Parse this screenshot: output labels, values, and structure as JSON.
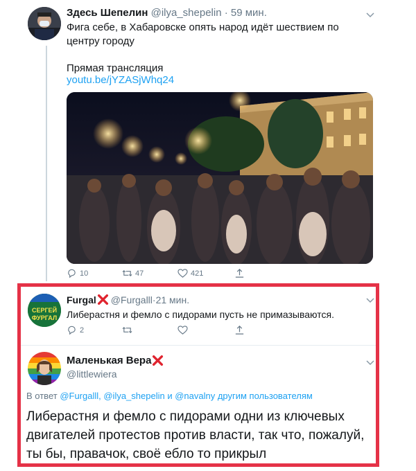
{
  "tweet_main": {
    "author_name": "Здесь Шепелин",
    "author_handle": "@ilya_shepelin",
    "separator": " · ",
    "time": "59 мин.",
    "text": "Фига себе, в Хабаровске опять народ идёт шествием по центру городу",
    "live_label": "Прямая трансляция",
    "link": "youtu.be/jYZASjWhq24",
    "replies": "10",
    "retweets": "47",
    "likes": "421"
  },
  "tweet_reply1": {
    "author_name": "Furgal",
    "author_handle": "@Furgalll",
    "separator": " · ",
    "time": "21 мин.",
    "text": "Либерастня и фемло с пидорами пусть не примазываются.",
    "replies": "2",
    "avatar_text_line1": "СЕРГЕЙ",
    "avatar_text_line2": "ФУРГАЛ"
  },
  "tweet_reply2": {
    "author_name": "Маленькая Вера",
    "author_handle": "@littlewiera",
    "reply_prefix": "В ответ ",
    "reply_users": "@Furgalll, @ilya_shepelin и @navalny другим пользователям",
    "text": "Либерастня и фемло с пидорами одни из ключевых двигателей протестов против власти, так что, пожалуй, ты бы, правачок, своё ебло то прикрыл"
  },
  "colors": {
    "accent": "#1da1f2",
    "highlight_border": "#e53247",
    "x_mark": "#e0242f",
    "muted": "#657786"
  }
}
